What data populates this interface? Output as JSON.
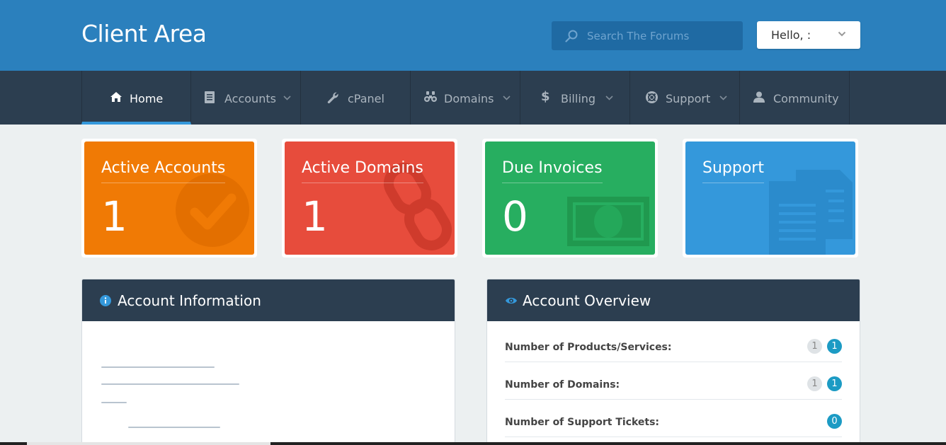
{
  "header": {
    "brand": "Client Area",
    "search_placeholder": "Search The Forums",
    "greeting": "Hello, :"
  },
  "nav": {
    "items": [
      {
        "label": "Home",
        "icon": "home-icon",
        "active": true
      },
      {
        "label": "Accounts",
        "icon": "document-icon"
      },
      {
        "label": "cPanel",
        "icon": "wrench-icon"
      },
      {
        "label": "Domains",
        "icon": "binoculars-icon"
      },
      {
        "label": "Billing",
        "icon": "dollar-icon"
      },
      {
        "label": "Support",
        "icon": "lifebuoy-icon"
      },
      {
        "label": "Community",
        "icon": "user-icon"
      }
    ]
  },
  "tiles": [
    {
      "title": "Active Accounts",
      "value": "1",
      "color": "#f07a05",
      "icon": "check-icon"
    },
    {
      "title": "Active Domains",
      "value": "1",
      "color": "#e74c3c",
      "icon": "link-icon"
    },
    {
      "title": "Due Invoices",
      "value": "0",
      "color": "#27ae60",
      "icon": "money-icon"
    },
    {
      "title": "Support",
      "value": "",
      "color": "#3498db",
      "icon": "documents-icon"
    }
  ],
  "account_info": {
    "title": "Account Information"
  },
  "account_overview": {
    "title": "Account Overview",
    "rows": [
      {
        "label": "Number of Products/Services:",
        "badges": [
          "1",
          "1"
        ]
      },
      {
        "label": "Number of Domains:",
        "badges": [
          "1",
          "1"
        ]
      },
      {
        "label": "Number of Support Tickets:",
        "badges": [
          "0"
        ]
      }
    ]
  },
  "colors": {
    "topbar": "#2b80bd",
    "navbar": "#2c3e50",
    "accent": "#3498db",
    "badge_blue": "#1c9bc4"
  }
}
